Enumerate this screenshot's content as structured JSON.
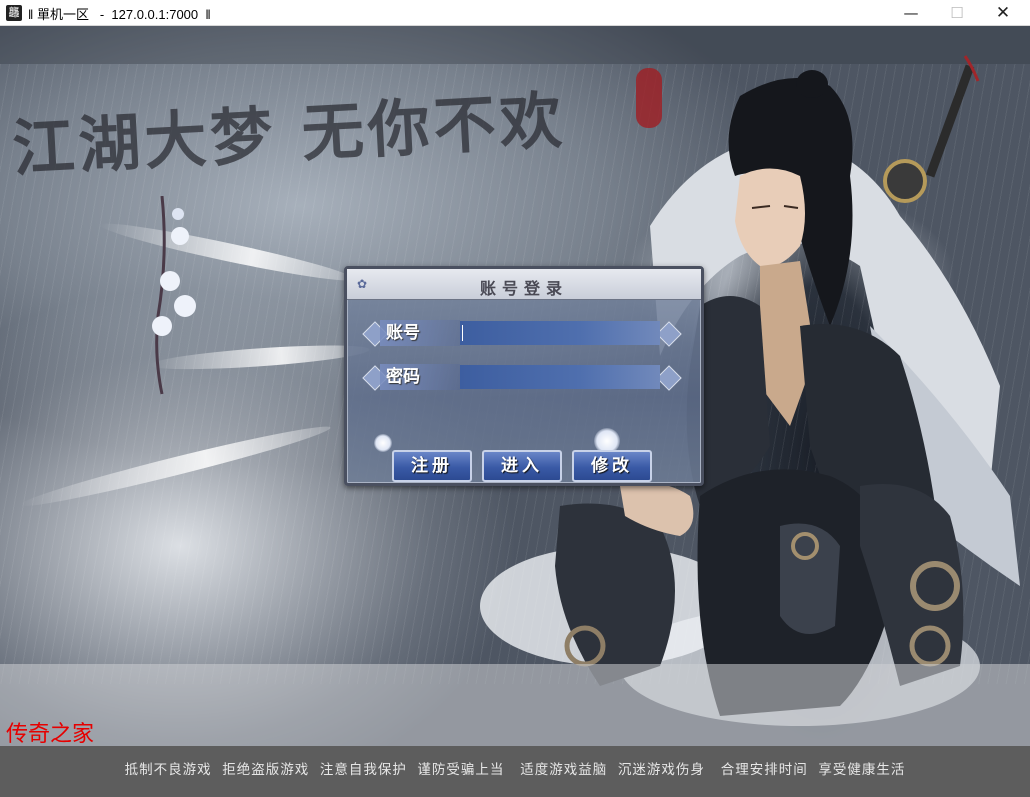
{
  "window": {
    "icon": "game-logo-icon",
    "title": "單机一区   -  127.0.0.1:7000  ‖",
    "title_prefix": "‖",
    "minimize": "—",
    "maximize": "☐",
    "close": "✕"
  },
  "banner": {
    "slogan": "江湖大梦 无你不欢"
  },
  "login": {
    "title": "账号登录",
    "account_label": "账号",
    "account_value": "",
    "password_label": "密码",
    "password_value": "",
    "buttons": {
      "register": "注册",
      "enter": "进入",
      "modify": "修改"
    }
  },
  "footer": {
    "site_name": "传奇之家",
    "notice": "抵制不良游戏  拒绝盗版游戏  注意自我保护  谨防受骗上当   适度游戏益脑  沉迷游戏伤身   合理安排时间  享受健康生活"
  },
  "colors": {
    "site_name": "#e60000",
    "button": "#3a5aa6",
    "panel": "#6b7ba0"
  }
}
